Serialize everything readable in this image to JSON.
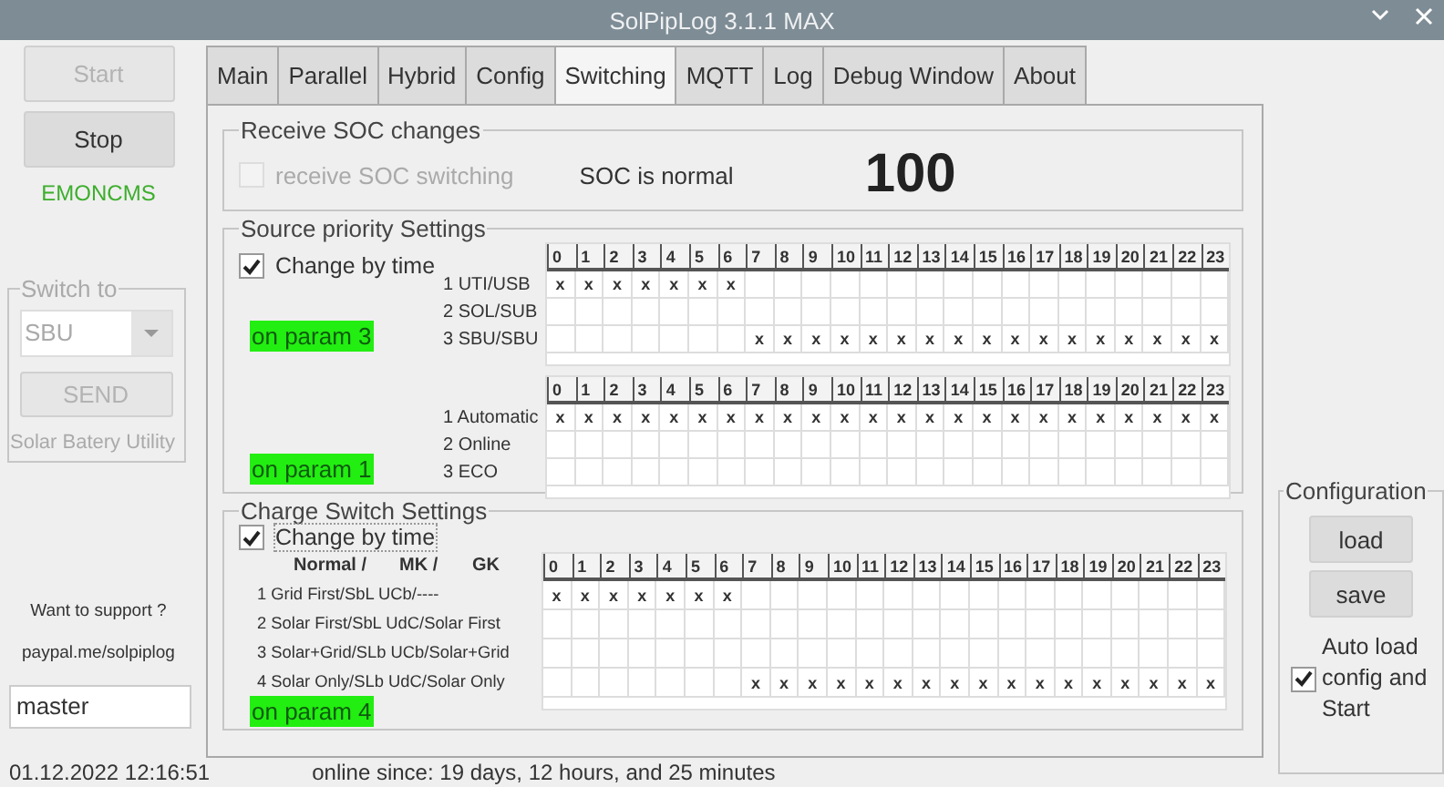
{
  "window": {
    "title": "SolPipLog 3.1.1 MAX"
  },
  "left": {
    "buttons": [
      {
        "label": "Start",
        "disabled": true
      },
      {
        "label": "Stop",
        "disabled": false
      }
    ],
    "service": "EMONCMS",
    "switch_to": {
      "title": "Switch to",
      "select": {
        "value": "SBU",
        "disabled": true
      },
      "send": {
        "label": "SEND",
        "disabled": true
      },
      "caption": "Solar Batery Utility"
    },
    "support": "Want to support ?",
    "link": "paypal.me/solpiplog",
    "branch": {
      "value": "master"
    }
  },
  "tabs": [
    {
      "label": "Main",
      "selected": false
    },
    {
      "label": "Parallel",
      "selected": false
    },
    {
      "label": "Hybrid",
      "selected": false
    },
    {
      "label": "Config",
      "selected": false
    },
    {
      "label": "Switching",
      "selected": true
    },
    {
      "label": "MQTT",
      "selected": false
    },
    {
      "label": "Log",
      "selected": false
    },
    {
      "label": "Debug Window",
      "selected": false
    },
    {
      "label": "About",
      "selected": false
    }
  ],
  "receive_soc": {
    "title": "Receive SOC changes",
    "checkbox": {
      "label": "receive SOC switching",
      "checked": false,
      "disabled": true
    },
    "status": "SOC is normal",
    "value": "100"
  },
  "source_priority": {
    "title": "Source priority Settings",
    "change_by_time": {
      "label": "Change by time",
      "checked": true
    },
    "tables": [
      {
        "param": "on param 3",
        "hours": [
          "0",
          "1",
          "2",
          "3",
          "4",
          "5",
          "6",
          "7",
          "8",
          "9",
          "10",
          "11",
          "12",
          "13",
          "14",
          "15",
          "16",
          "17",
          "18",
          "19",
          "20",
          "21",
          "22",
          "23"
        ],
        "rows": [
          {
            "label": "1 UTI/USB",
            "cells": [
              "x",
              "x",
              "x",
              "x",
              "x",
              "x",
              "x",
              null,
              null,
              null,
              null,
              null,
              null,
              null,
              null,
              null,
              null,
              null,
              null,
              null,
              null,
              null,
              null,
              null
            ]
          },
          {
            "label": "2 SOL/SUB",
            "cells": [
              null,
              null,
              null,
              null,
              null,
              null,
              null,
              null,
              null,
              null,
              null,
              null,
              null,
              null,
              null,
              null,
              null,
              null,
              null,
              null,
              null,
              null,
              null,
              null
            ]
          },
          {
            "label": "3 SBU/SBU",
            "cells": [
              null,
              null,
              null,
              null,
              null,
              null,
              null,
              "x",
              "x",
              "x",
              "x",
              "x",
              "x",
              "x",
              "x",
              "x",
              "x",
              "x",
              "x",
              "x",
              "x",
              "x",
              "x",
              "x"
            ]
          }
        ]
      },
      {
        "param": "on param 1",
        "hours": [
          "0",
          "1",
          "2",
          "3",
          "4",
          "5",
          "6",
          "7",
          "8",
          "9",
          "10",
          "11",
          "12",
          "13",
          "14",
          "15",
          "16",
          "17",
          "18",
          "19",
          "20",
          "21",
          "22",
          "23"
        ],
        "rows": [
          {
            "label": "1 Automatic",
            "cells": [
              "x",
              "x",
              "x",
              "x",
              "x",
              "x",
              "x",
              "x",
              "x",
              "x",
              "x",
              "x",
              "x",
              "x",
              "x",
              "x",
              "x",
              "x",
              "x",
              "x",
              "x",
              "x",
              "x",
              "x"
            ]
          },
          {
            "label": "2 Online",
            "cells": [
              null,
              null,
              null,
              null,
              null,
              null,
              null,
              null,
              null,
              null,
              null,
              null,
              null,
              null,
              null,
              null,
              null,
              null,
              null,
              null,
              null,
              null,
              null,
              null
            ]
          },
          {
            "label": "3 ECO",
            "cells": [
              null,
              null,
              null,
              null,
              null,
              null,
              null,
              null,
              null,
              null,
              null,
              null,
              null,
              null,
              null,
              null,
              null,
              null,
              null,
              null,
              null,
              null,
              null,
              null
            ]
          }
        ]
      }
    ]
  },
  "charge_switch": {
    "title": "Charge Switch Settings",
    "change_by_time": {
      "label": "Change by time",
      "checked": true
    },
    "header": [
      "Normal /",
      "MK /",
      "GK"
    ],
    "param": "on param 4",
    "hours": [
      "0",
      "1",
      "2",
      "3",
      "4",
      "5",
      "6",
      "7",
      "8",
      "9",
      "10",
      "11",
      "12",
      "13",
      "14",
      "15",
      "16",
      "17",
      "18",
      "19",
      "20",
      "21",
      "22",
      "23"
    ],
    "rows": [
      {
        "label": "1 Grid First/SbL UCb/----",
        "cells": [
          "x",
          "x",
          "x",
          "x",
          "x",
          "x",
          "x",
          null,
          null,
          null,
          null,
          null,
          null,
          null,
          null,
          null,
          null,
          null,
          null,
          null,
          null,
          null,
          null,
          null
        ]
      },
      {
        "label": "2 Solar First/SbL UdC/Solar First",
        "cells": [
          null,
          null,
          null,
          null,
          null,
          null,
          null,
          null,
          null,
          null,
          null,
          null,
          null,
          null,
          null,
          null,
          null,
          null,
          null,
          null,
          null,
          null,
          null,
          null
        ]
      },
      {
        "label": "3 Solar+Grid/SLb UCb/Solar+Grid",
        "cells": [
          null,
          null,
          null,
          null,
          null,
          null,
          null,
          null,
          null,
          null,
          null,
          null,
          null,
          null,
          null,
          null,
          null,
          null,
          null,
          null,
          null,
          null,
          null,
          null
        ]
      },
      {
        "label": "4 Solar Only/SLb UdC/Solar Only",
        "cells": [
          null,
          null,
          null,
          null,
          null,
          null,
          null,
          "x",
          "x",
          "x",
          "x",
          "x",
          "x",
          "x",
          "x",
          "x",
          "x",
          "x",
          "x",
          "x",
          "x",
          "x",
          "x",
          "x"
        ]
      }
    ]
  },
  "configuration": {
    "title": "Configuration",
    "buttons": [
      {
        "label": "load"
      },
      {
        "label": "save"
      }
    ],
    "auto_start": {
      "label": "Auto load config and Start",
      "checked": true
    }
  },
  "status_bar": {
    "timestamp": "01.12.2022 12:16:51",
    "uptime": "online since: 19 days, 12 hours, and 25 minutes"
  }
}
